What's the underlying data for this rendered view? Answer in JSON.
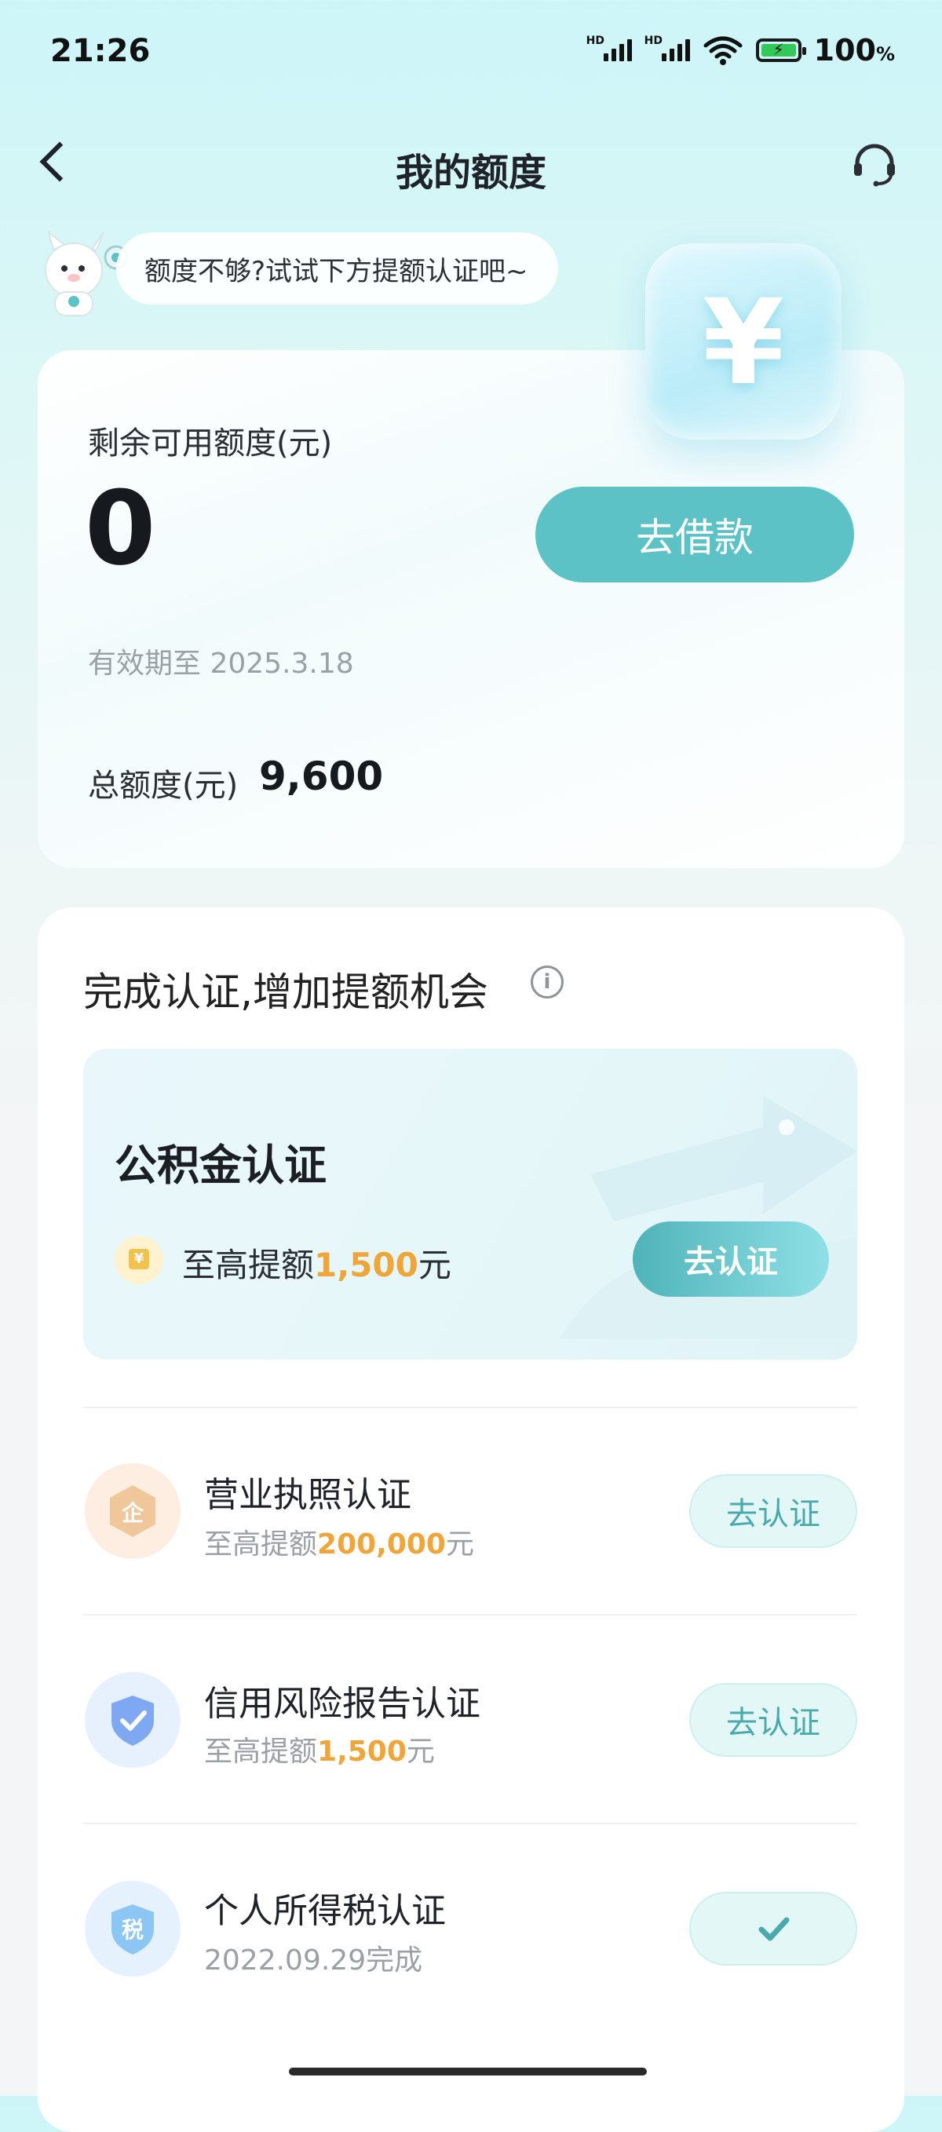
{
  "status_bar": {
    "time": "21:26",
    "signal_1": "HD",
    "signal_2": "HD",
    "battery": "100",
    "battery_unit": "%"
  },
  "nav": {
    "title": "我的额度"
  },
  "tip": {
    "text": "额度不够?试试下方提额认证吧~"
  },
  "credit": {
    "remaining_label": "剩余可用额度(元)",
    "remaining_value": "0",
    "borrow_button": "去借款",
    "validity": "有效期至 2025.3.18",
    "total_label": "总额度(元)",
    "total_value": "9,600",
    "yen_symbol": "¥"
  },
  "certification": {
    "title": "完成认证,增加提额机会",
    "info_symbol": "i",
    "featured": {
      "title": "公积金认证",
      "prefix": "至高提额",
      "amount": "1,500",
      "suffix": "元",
      "button": "去认证",
      "coin_symbol": "¥"
    },
    "items": [
      {
        "title": "营业执照认证",
        "prefix": "至高提额",
        "amount": "200,000",
        "suffix": "元",
        "button": "去认证",
        "icon_char": "企"
      },
      {
        "title": "信用风险报告认证",
        "prefix": "至高提额",
        "amount": "1,500",
        "suffix": "元",
        "button": "去认证"
      },
      {
        "title": "个人所得税认证",
        "status": "2022.09.29完成",
        "icon_char": "税"
      }
    ]
  },
  "colors": {
    "accent": "#5cc2c6",
    "orange": "#f0a53b"
  }
}
